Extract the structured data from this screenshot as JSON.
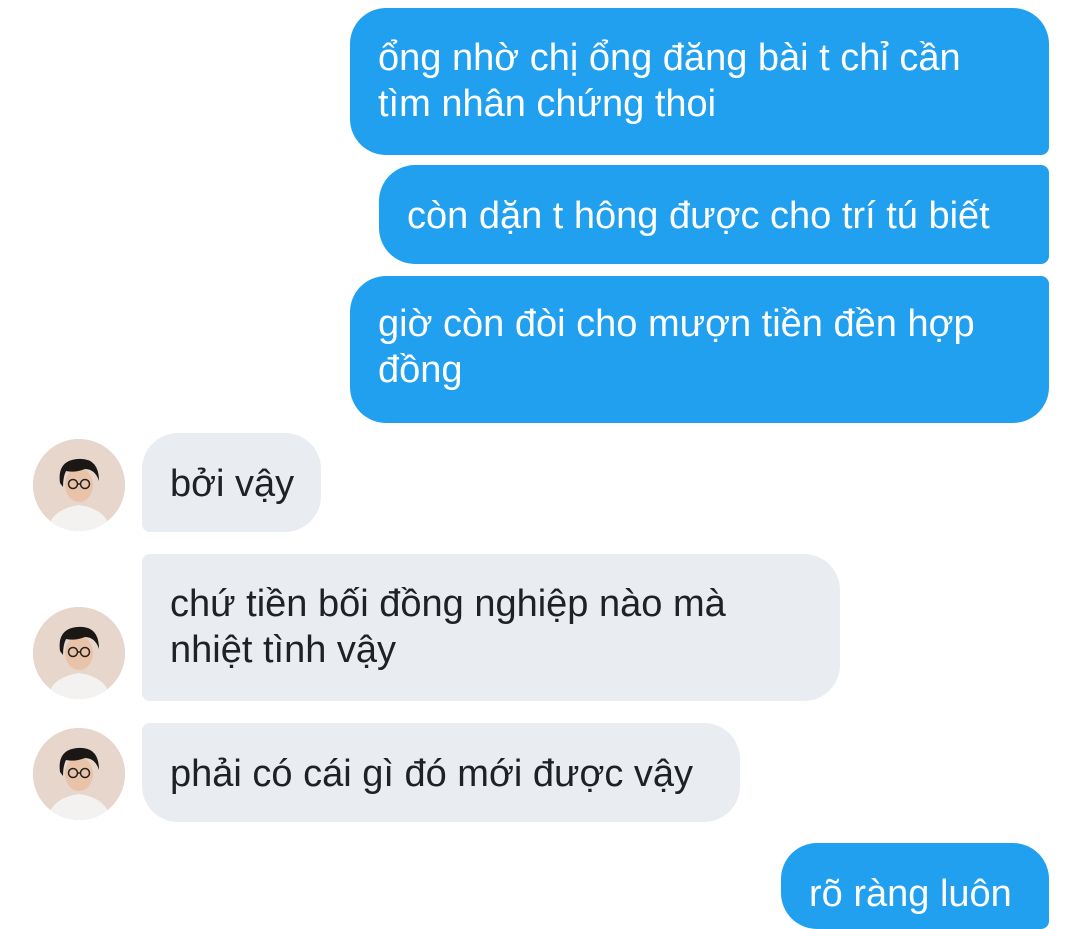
{
  "messages": [
    {
      "id": "m1",
      "direction": "outgoing",
      "text": "ổng nhờ chị ổng đăng bài t chỉ cần tìm nhân chứng thoi"
    },
    {
      "id": "m2",
      "direction": "outgoing",
      "text": "còn dặn t hông được cho trí tú biết"
    },
    {
      "id": "m3",
      "direction": "outgoing",
      "text": "giờ còn đòi cho mượn tiền đền hợp đồng"
    },
    {
      "id": "m4",
      "direction": "incoming",
      "text": "bởi vậy",
      "avatar": "contact-avatar"
    },
    {
      "id": "m5",
      "direction": "incoming",
      "text": "chứ tiền bối đồng nghiệp nào mà nhiệt tình vậy",
      "avatar": "contact-avatar"
    },
    {
      "id": "m6",
      "direction": "incoming",
      "text": "phải có cái gì đó mới được vậy",
      "avatar": "contact-avatar"
    },
    {
      "id": "m7",
      "direction": "outgoing",
      "text": "rõ ràng luôn"
    }
  ],
  "colors": {
    "outgoing_bubble": "#21a0ef",
    "outgoing_text": "#ffffff",
    "incoming_bubble": "#e9ecf0",
    "incoming_text": "#202124"
  }
}
